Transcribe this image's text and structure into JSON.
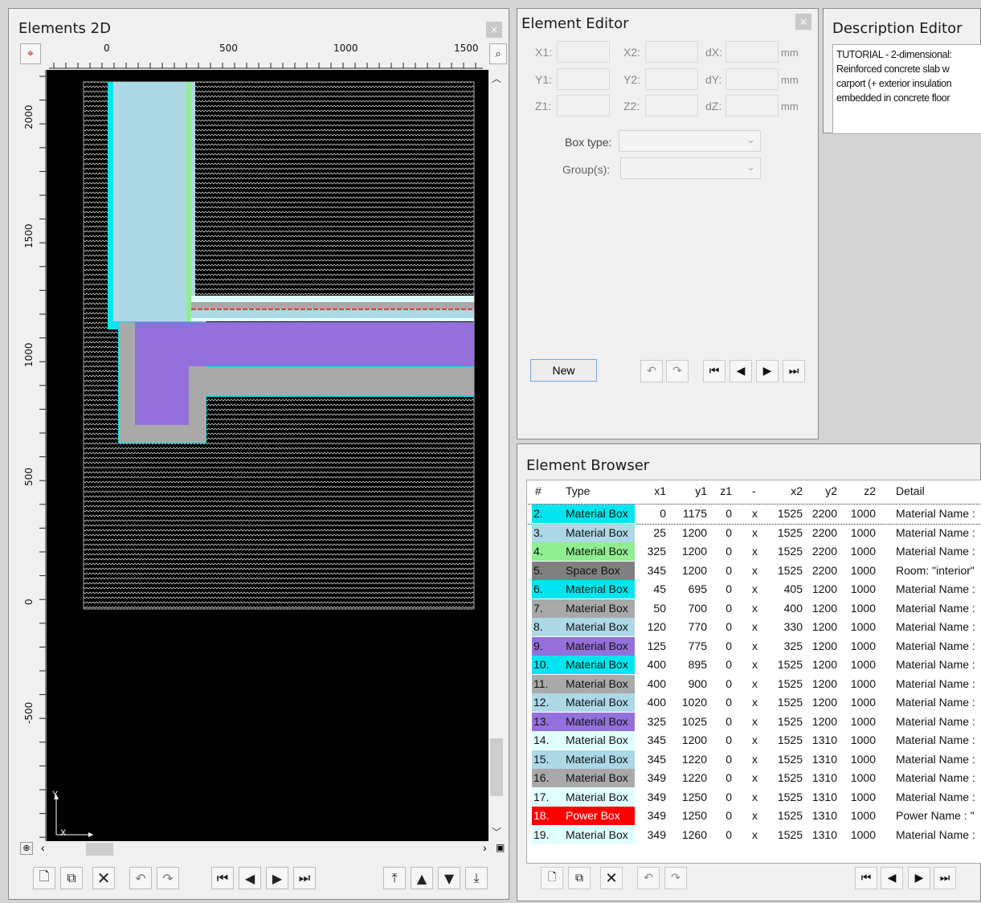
{
  "elements2d": {
    "title": "Elements 2D",
    "x_ticks": [
      "0",
      "500",
      "1000",
      "1500"
    ],
    "y_ticks": [
      "2000",
      "1500",
      "1000",
      "500",
      "0",
      "-500"
    ],
    "axis_x": "X",
    "axis_y": "Y"
  },
  "editor": {
    "title": "Element Editor",
    "labels": {
      "x1": "X1:",
      "y1": "Y1:",
      "z1": "Z1:",
      "x2": "X2:",
      "y2": "Y2:",
      "z2": "Z2:",
      "dx": "dX:",
      "dy": "dY:",
      "dz": "dZ:"
    },
    "unit": "mm",
    "box_type_label": "Box type:",
    "groups_label": "Group(s):",
    "new_label": "New"
  },
  "description": {
    "title": "Description Editor",
    "text": "TUTORIAL - 2-dimensional:\nReinforced concrete slab w\ncarport (+ exterior insulation\nembedded in concrete floor"
  },
  "browser": {
    "title": "Element Browser",
    "headers": [
      "#",
      "Type",
      "x1",
      "y1",
      "z1",
      "-",
      "x2",
      "y2",
      "z2",
      "Detail"
    ],
    "rows": [
      {
        "n": "2.",
        "type": "Material Box",
        "x1": "0",
        "y1": "1175",
        "z1": "0",
        "sep": "x",
        "x2": "1525",
        "y2": "2200",
        "z2": "1000",
        "detail": "Material Name :",
        "color": "#00e5ee"
      },
      {
        "n": "3.",
        "type": "Material Box",
        "x1": "25",
        "y1": "1200",
        "z1": "0",
        "sep": "x",
        "x2": "1525",
        "y2": "2200",
        "z2": "1000",
        "detail": "Material Name :",
        "color": "#add8e6"
      },
      {
        "n": "4.",
        "type": "Material Box",
        "x1": "325",
        "y1": "1200",
        "z1": "0",
        "sep": "x",
        "x2": "1525",
        "y2": "2200",
        "z2": "1000",
        "detail": "Material Name :",
        "color": "#90ee90"
      },
      {
        "n": "5.",
        "type": "Space Box",
        "x1": "345",
        "y1": "1200",
        "z1": "0",
        "sep": "x",
        "x2": "1525",
        "y2": "2200",
        "z2": "1000",
        "detail": "Room: \"interior\"",
        "color": "#808080"
      },
      {
        "n": "6.",
        "type": "Material Box",
        "x1": "45",
        "y1": "695",
        "z1": "0",
        "sep": "x",
        "x2": "405",
        "y2": "1200",
        "z2": "1000",
        "detail": "Material Name :",
        "color": "#00e5ee"
      },
      {
        "n": "7.",
        "type": "Material Box",
        "x1": "50",
        "y1": "700",
        "z1": "0",
        "sep": "x",
        "x2": "400",
        "y2": "1200",
        "z2": "1000",
        "detail": "Material Name :",
        "color": "#a9a9a9"
      },
      {
        "n": "8.",
        "type": "Material Box",
        "x1": "120",
        "y1": "770",
        "z1": "0",
        "sep": "x",
        "x2": "330",
        "y2": "1200",
        "z2": "1000",
        "detail": "Material Name :",
        "color": "#add8e6"
      },
      {
        "n": "9.",
        "type": "Material Box",
        "x1": "125",
        "y1": "775",
        "z1": "0",
        "sep": "x",
        "x2": "325",
        "y2": "1200",
        "z2": "1000",
        "detail": "Material Name :",
        "color": "#9370db"
      },
      {
        "n": "10.",
        "type": "Material Box",
        "x1": "400",
        "y1": "895",
        "z1": "0",
        "sep": "x",
        "x2": "1525",
        "y2": "1200",
        "z2": "1000",
        "detail": "Material Name :",
        "color": "#00e5ee"
      },
      {
        "n": "11.",
        "type": "Material Box",
        "x1": "400",
        "y1": "900",
        "z1": "0",
        "sep": "x",
        "x2": "1525",
        "y2": "1200",
        "z2": "1000",
        "detail": "Material Name :",
        "color": "#a9a9a9"
      },
      {
        "n": "12.",
        "type": "Material Box",
        "x1": "400",
        "y1": "1020",
        "z1": "0",
        "sep": "x",
        "x2": "1525",
        "y2": "1200",
        "z2": "1000",
        "detail": "Material Name :",
        "color": "#add8e6"
      },
      {
        "n": "13.",
        "type": "Material Box",
        "x1": "325",
        "y1": "1025",
        "z1": "0",
        "sep": "x",
        "x2": "1525",
        "y2": "1200",
        "z2": "1000",
        "detail": "Material Name :",
        "color": "#9370db"
      },
      {
        "n": "14.",
        "type": "Material Box",
        "x1": "345",
        "y1": "1200",
        "z1": "0",
        "sep": "x",
        "x2": "1525",
        "y2": "1310",
        "z2": "1000",
        "detail": "Material Name :",
        "color": "#e0ffff"
      },
      {
        "n": "15.",
        "type": "Material Box",
        "x1": "345",
        "y1": "1220",
        "z1": "0",
        "sep": "x",
        "x2": "1525",
        "y2": "1310",
        "z2": "1000",
        "detail": "Material Name :",
        "color": "#add8e6"
      },
      {
        "n": "16.",
        "type": "Material Box",
        "x1": "349",
        "y1": "1220",
        "z1": "0",
        "sep": "x",
        "x2": "1525",
        "y2": "1310",
        "z2": "1000",
        "detail": "Material Name :",
        "color": "#a9a9a9"
      },
      {
        "n": "17.",
        "type": "Material Box",
        "x1": "349",
        "y1": "1250",
        "z1": "0",
        "sep": "x",
        "x2": "1525",
        "y2": "1310",
        "z2": "1000",
        "detail": "Material Name :",
        "color": "#e0ffff"
      },
      {
        "n": "18.",
        "type": "Power Box",
        "x1": "349",
        "y1": "1250",
        "z1": "0",
        "sep": "x",
        "x2": "1525",
        "y2": "1310",
        "z2": "1000",
        "detail": "Power Name : \"",
        "color": "#ff0000"
      },
      {
        "n": "19.",
        "type": "Material Box",
        "x1": "349",
        "y1": "1260",
        "z1": "0",
        "sep": "x",
        "x2": "1525",
        "y2": "1310",
        "z2": "1000",
        "detail": "Material Name :",
        "color": "#e0ffff"
      }
    ]
  }
}
